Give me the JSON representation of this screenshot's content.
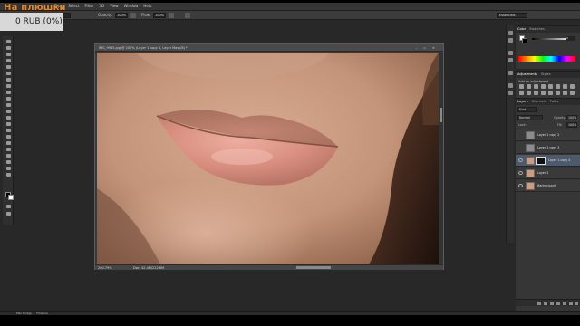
{
  "app": {
    "menu": [
      "Type",
      "Select",
      "Filter",
      "3D",
      "View",
      "Window",
      "Help"
    ],
    "brand_overlay": "На плюшки",
    "donate_badge": "0 RUB (0%)",
    "workspace": "Essentials"
  },
  "options_bar": {
    "opacity_label": "Opacity:",
    "opacity_value": "100%",
    "flow_label": "Flow:",
    "flow_value": "100%",
    "mode_value": "Normal"
  },
  "document": {
    "title": "IMG_9985.jpg @ 200% (Layer 1 copy 4, Layer Mask/8) *",
    "zoom": "200.79%",
    "doc_size": "Doc: 42.4M/222.6M",
    "window_buttons": [
      "–",
      "▫",
      "✕"
    ]
  },
  "color_panel": {
    "tabs": [
      "Color",
      "Swatches"
    ],
    "k_value": "0"
  },
  "adjustments_panel": {
    "tabs": [
      "Adjustments",
      "Styles"
    ],
    "title": "Add an adjustment"
  },
  "layers_panel": {
    "tabs": [
      "Layers",
      "Channels",
      "Paths"
    ],
    "kind_filter": "Kind",
    "blend_mode": "Normal",
    "opacity_label": "Opacity:",
    "opacity_value": "100%",
    "lock_label": "Lock:",
    "fill_label": "Fill:",
    "fill_value": "100%",
    "layers": [
      {
        "name": "Layer 1 copy 2",
        "visible": false,
        "selected": false,
        "has_mask": false,
        "thumb": "gray"
      },
      {
        "name": "Layer 1 copy 3",
        "visible": false,
        "selected": false,
        "has_mask": false,
        "thumb": "gray"
      },
      {
        "name": "Layer 1 copy 4",
        "visible": true,
        "selected": true,
        "has_mask": true,
        "thumb": "photo"
      },
      {
        "name": "Layer 1",
        "visible": true,
        "selected": false,
        "has_mask": false,
        "thumb": "photo"
      },
      {
        "name": "Background",
        "visible": true,
        "selected": false,
        "has_mask": false,
        "thumb": "photo",
        "italic": true
      }
    ]
  },
  "bottom_bar": {
    "tabs": [
      "Mini Bridge",
      "Timeline"
    ]
  },
  "colors": {
    "brand": "#e08a32",
    "selected_layer": "#4d5a6b",
    "panel_bg": "#363636"
  }
}
